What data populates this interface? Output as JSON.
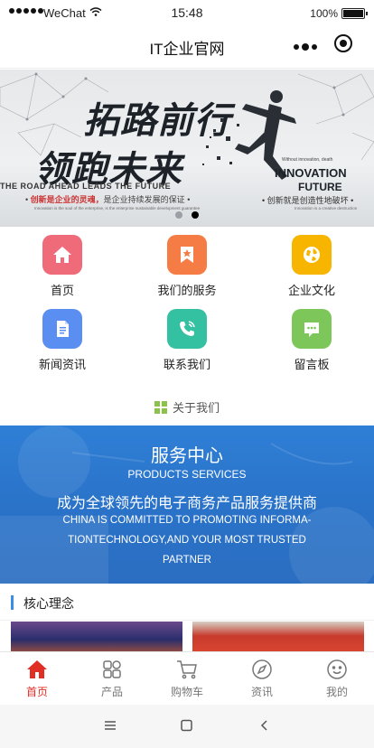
{
  "status_bar": {
    "carrier": "WeChat",
    "time": "15:48",
    "battery": "100%"
  },
  "navbar": {
    "title": "IT企业官网"
  },
  "banner": {
    "headline_1": "拓路前行",
    "headline_2": "领跑未来",
    "tagline_en": "THE ROAD AHEAD LEADS THE FUTURE",
    "slogan_left_a": "创新是企业的灵魂，",
    "slogan_left_b": "是企业持续发展的保证",
    "caption_left": "Innovation is the soul of the enterprise,      is the enterprise sustainable development guarantee",
    "innovation_caption": "Without innovation,    death",
    "innovation": "INNOVATION",
    "future": "FUTURE",
    "slogan_right": "创新就是创造性地破坏",
    "caption_right": "Innovation is a creative destruction",
    "slide_count": 2,
    "active_slide": 2
  },
  "menu": [
    {
      "label": "首页",
      "icon": "home-icon",
      "color": "#ef6b7a"
    },
    {
      "label": "我们的服务",
      "icon": "star-bookmark-icon",
      "color": "#f57c45"
    },
    {
      "label": "企业文化",
      "icon": "globe-icon",
      "color": "#f7b500"
    },
    {
      "label": "新闻资讯",
      "icon": "document-icon",
      "color": "#5a8ef0"
    },
    {
      "label": "联系我们",
      "icon": "phone-icon",
      "color": "#34c1a1"
    },
    {
      "label": "留言板",
      "icon": "message-icon",
      "color": "#7cc65a"
    }
  ],
  "about": {
    "label": "关于我们",
    "icon_color": "#8bc34a"
  },
  "service": {
    "title": "服务中心",
    "subtitle": "PRODUCTS SERVICES",
    "tagline_cn": "成为全球领先的电子商务产品服务提供商",
    "tagline_en_1": "CHINA IS COMMITTED TO PROMOTING INFORMA-",
    "tagline_en_2": "TIONTECHNOLOGY,AND YOUR MOST TRUSTED",
    "tagline_en_3": "PARTNER"
  },
  "core": {
    "title": "核心理念",
    "accent": "#3a8ee6"
  },
  "tabbar": {
    "items": [
      {
        "label": "首页",
        "icon": "home-icon",
        "active": true
      },
      {
        "label": "产品",
        "icon": "grid-icon",
        "active": false
      },
      {
        "label": "购物车",
        "icon": "cart-icon",
        "active": false
      },
      {
        "label": "资讯",
        "icon": "compass-icon",
        "active": false
      },
      {
        "label": "我的",
        "icon": "smiley-icon",
        "active": false
      }
    ],
    "active_color": "#e02e24"
  }
}
